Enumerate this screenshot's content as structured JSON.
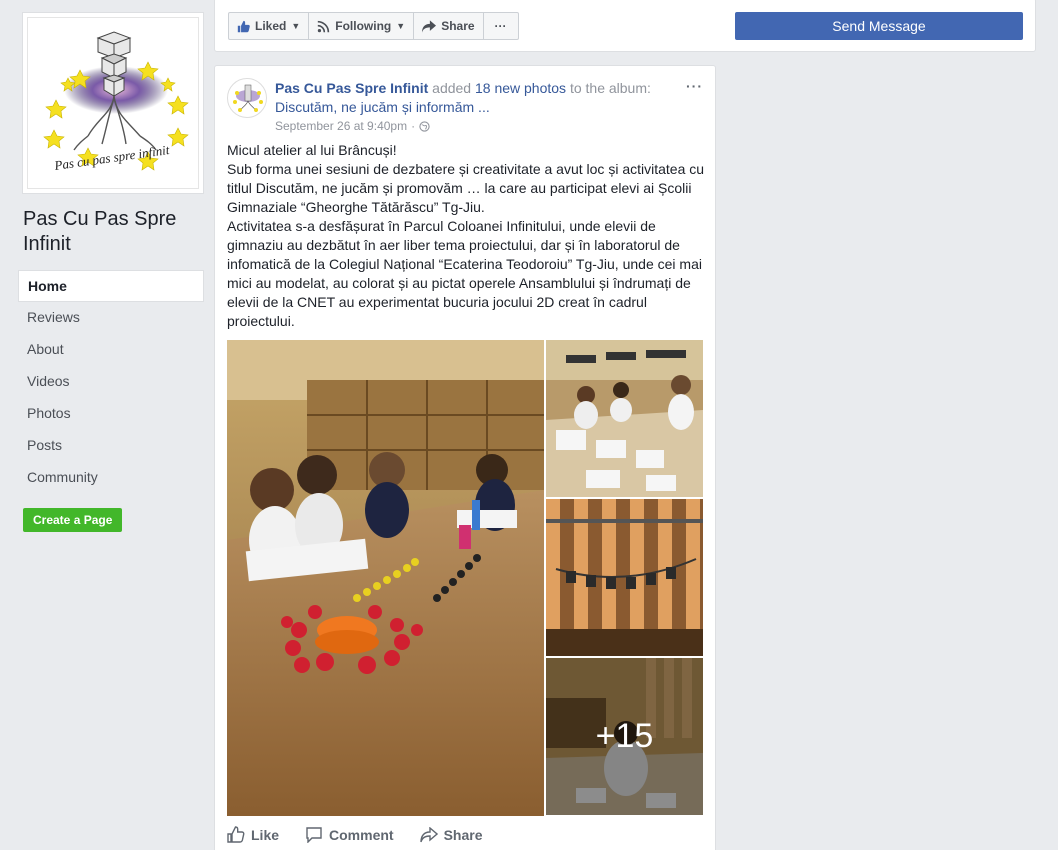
{
  "sidebar": {
    "logo_text": "Pas cu pas spre infinit",
    "page_name": "Pas Cu Pas Spre Infinit",
    "nav": [
      "Home",
      "Reviews",
      "About",
      "Videos",
      "Photos",
      "Posts",
      "Community"
    ],
    "active": "Home",
    "create_page": "Create a Page"
  },
  "actions": {
    "liked": "Liked",
    "following": "Following",
    "share": "Share",
    "more": "···",
    "send_message": "Send Message"
  },
  "post": {
    "author": "Pas Cu Pas Spre Infinit",
    "added": "added",
    "photos_link": "18 new photos",
    "to_the": "to the",
    "album_prefix": "album:",
    "album": "Discutăm, ne jucăm și informăm ...",
    "time": "September 26 at 9:40pm",
    "separator": "·",
    "more": "···",
    "lines": [
      "Micul atelier al lui Brâncuși!",
      "Sub forma unei sesiuni de dezbatere și creativitate a avut loc și activitatea cu titlul Discutăm, ne jucăm și promovăm … la care au participat elevi ai Școlii Gimnaziale “Gheorghe Tătărăscu” Tg-Jiu.",
      "Activitatea s-a desfășurat în Parcul Coloanei Infinitului, unde elevii de gimnaziu au dezbătut în aer liber tema proiectului, dar și în laboratorul de infomatică de la Colegiul Național “Ecaterina Teodoroiu” Tg-Jiu, unde cei mai mici au modelat, au colorat și au pictat operele Ansamblului și îndrumați de elevii de la CNET au experimentat bucuria jocului 2D creat în cadrul proiectului."
    ],
    "more_photos": "+15",
    "like": "Like",
    "comment": "Comment",
    "share": "Share"
  },
  "colors": {
    "link": "#365899",
    "primary": "#4267b2",
    "create": "#42b72a",
    "background": "#e9ebee"
  }
}
